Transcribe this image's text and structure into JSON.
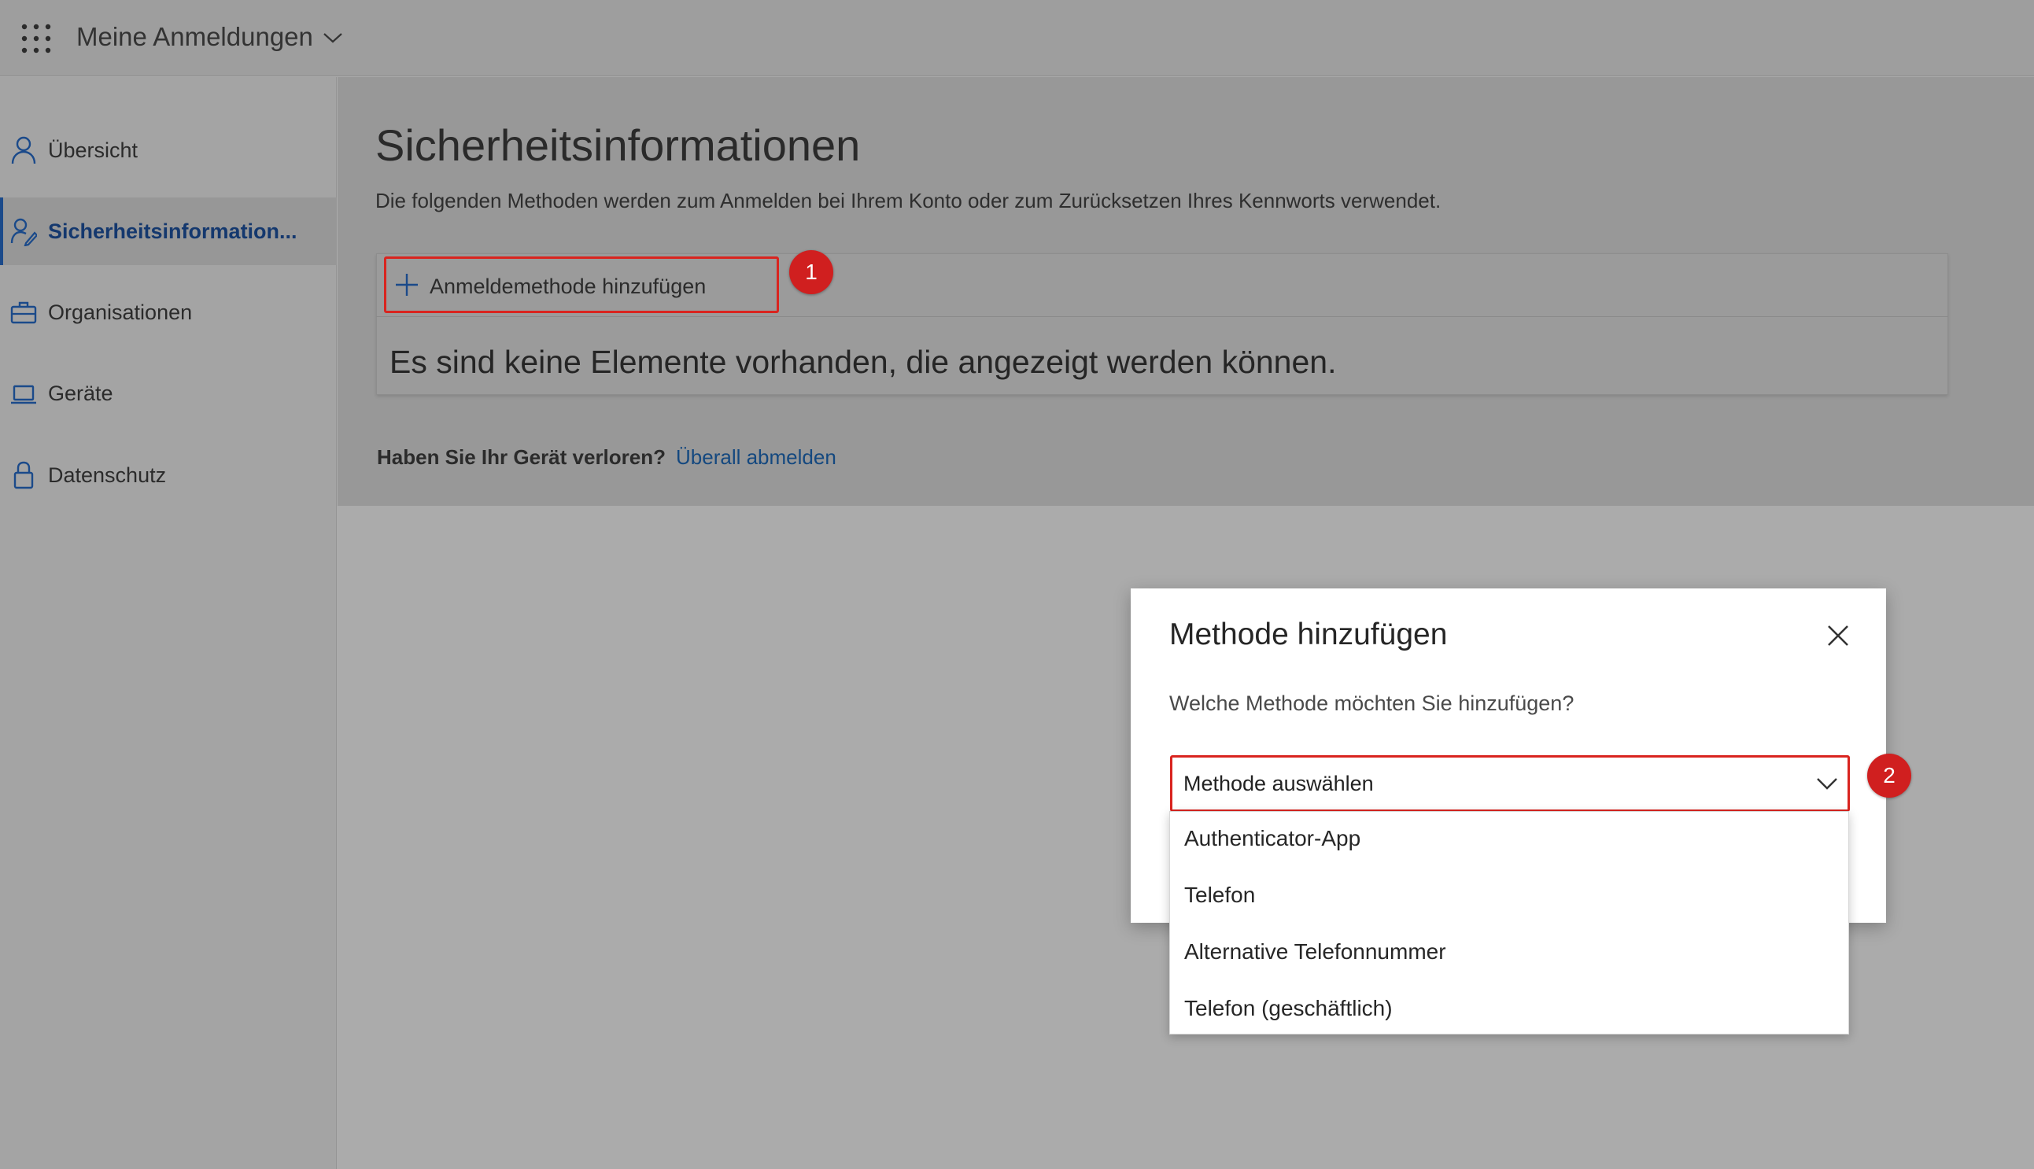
{
  "header": {
    "app_title": "Meine Anmeldungen",
    "waffle_icon": "app-launcher-icon",
    "chevron_icon": "chevron-down-icon"
  },
  "sidebar": {
    "items": [
      {
        "label": "Übersicht",
        "icon": "person-icon",
        "active": false
      },
      {
        "label": "Sicherheitsinformation...",
        "icon": "security-info-icon",
        "active": true
      },
      {
        "label": "Organisationen",
        "icon": "briefcase-icon",
        "active": false
      },
      {
        "label": "Geräte",
        "icon": "laptop-icon",
        "active": false
      },
      {
        "label": "Datenschutz",
        "icon": "lock-icon",
        "active": false
      }
    ],
    "active_color": "#14386e"
  },
  "main": {
    "title": "Sicherheitsinformationen",
    "description": "Die folgenden Methoden werden zum Anmelden bei Ihrem Konto oder zum Zurücksetzen Ihres Kennworts verwendet.",
    "add_method_label": "Anmeldemethode hinzufügen",
    "empty_message": "Es sind keine Elemente vorhanden, die angezeigt werden können.",
    "lost_device_question": "Haben Sie Ihr Gerät verloren?",
    "sign_out_everywhere_link": "Überall abmelden"
  },
  "annotations": {
    "badge_1": "1",
    "badge_2": "2",
    "highlight_color": "#d9241f"
  },
  "modal": {
    "title": "Methode hinzufügen",
    "question": "Welche Methode möchten Sie hinzufügen?",
    "select_value": "Methode auswählen",
    "options": [
      "Authenticator-App",
      "Telefon",
      "Alternative Telefonnummer",
      "Telefon (geschäftlich)"
    ]
  }
}
